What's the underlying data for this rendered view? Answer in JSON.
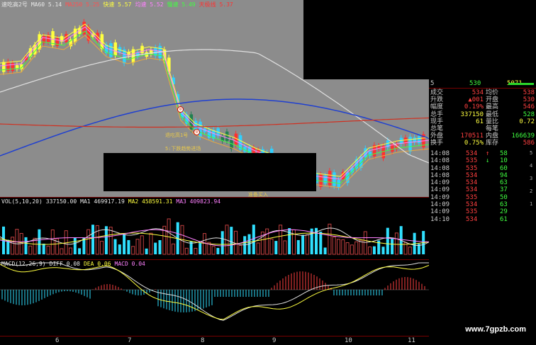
{
  "main": {
    "title_items": [
      {
        "text": "速吃高2号",
        "color": "#e8e8e8"
      },
      {
        "text": "MA60 5.14",
        "color": "#e8e8e8"
      },
      {
        "text": "MA250 5.25",
        "color": "#ff5050"
      },
      {
        "text": "快速 5.57",
        "color": "#ffff40"
      },
      {
        "text": "均速 5.52",
        "color": "#ff80ff"
      },
      {
        "text": "慢速 5.49",
        "color": "#40ff40"
      },
      {
        "text": "天极线 5.37",
        "color": "#ff3030"
      }
    ],
    "labels": [
      {
        "text": "退吃高1号",
        "color": "#e8c84a"
      },
      {
        "text": "5:下跌趋势进场",
        "color": "#e8c84a"
      },
      {
        "text": "准备买入",
        "color": "#e8c84a"
      }
    ]
  },
  "volume": {
    "title_items": [
      {
        "text": "VOL(5,10,20)",
        "color": "#e8e8e8"
      },
      {
        "text": "337150.00",
        "color": "#e8e8e8"
      },
      {
        "text": "MA1 469917.19",
        "color": "#e8e8e8"
      },
      {
        "text": "MA2 458591.31",
        "color": "#ffff40"
      },
      {
        "text": "MA3 409823.94",
        "color": "#ff80ff"
      }
    ]
  },
  "macd": {
    "title_items": [
      {
        "text": "MACD(12,26,9)",
        "color": "#e8e8e8"
      },
      {
        "text": "DIFF 0.08",
        "color": "#e8e8e8"
      },
      {
        "text": "DEA 0.06",
        "color": "#ffff40"
      },
      {
        "text": "MACD 0.04",
        "color": "#ff80ff"
      }
    ]
  },
  "xaxis": [
    "6",
    "7",
    "8",
    "9",
    "10",
    "11"
  ],
  "sidebar": {
    "header": {
      "left": "5",
      "buy_val": "530",
      "mid": "5071"
    },
    "quote_rows": [
      {
        "l1": "成交",
        "v1": "534",
        "c1": "#ff4040",
        "l2": "均价",
        "v2": "538",
        "c2": "#ff4040"
      },
      {
        "l1": "升跌",
        "v1": "▲001",
        "c1": "#ff4040",
        "l2": "开盘",
        "v2": "530",
        "c2": "#ff4040"
      },
      {
        "l1": "幅度",
        "v1": "0.19%",
        "c1": "#ff4040",
        "l2": "最高",
        "v2": "546",
        "c2": "#ff4040"
      },
      {
        "l1": "总手",
        "v1": "337150",
        "c1": "#ffff40",
        "l2": "最低",
        "v2": "528",
        "c2": "#40ff40"
      },
      {
        "l1": "现手",
        "v1": "61",
        "c1": "#ffff40",
        "l2": "量比",
        "v2": "0.72",
        "c2": "#ffff40"
      },
      {
        "l1": "总笔",
        "v1": "",
        "c1": "#ffff40",
        "l2": "每笔",
        "v2": "",
        "c2": "#ffff40"
      },
      {
        "l1": "外盘",
        "v1": "170511",
        "c1": "#ff4040",
        "l2": "内盘",
        "v2": "166639",
        "c2": "#40ff40"
      },
      {
        "l1": "换手",
        "v1": "0.75%",
        "c1": "#ffff40",
        "l2": "库存",
        "v2": "586",
        "c2": "#ff4040"
      }
    ],
    "trades": [
      {
        "time": "14:08",
        "price": "534",
        "qty": "58",
        "arrow": "↑"
      },
      {
        "time": "14:08",
        "price": "535",
        "qty": "10",
        "arrow": "↓"
      },
      {
        "time": "14:08",
        "price": "535",
        "qty": "60",
        "arrow": ""
      },
      {
        "time": "14:08",
        "price": "534",
        "qty": "94",
        "arrow": ""
      },
      {
        "time": "14:09",
        "price": "534",
        "qty": "63",
        "arrow": ""
      },
      {
        "time": "14:09",
        "price": "534",
        "qty": "37",
        "arrow": ""
      },
      {
        "time": "14:09",
        "price": "535",
        "qty": "50",
        "arrow": ""
      },
      {
        "time": "14:09",
        "price": "534",
        "qty": "63",
        "arrow": ""
      },
      {
        "time": "14:09",
        "price": "535",
        "qty": "29",
        "arrow": ""
      },
      {
        "time": "14:10",
        "price": "534",
        "qty": "61",
        "arrow": ""
      }
    ],
    "right_scale": [
      "5",
      "4",
      "3",
      "2",
      "1"
    ]
  },
  "watermark": "www.7gpzb.com"
}
